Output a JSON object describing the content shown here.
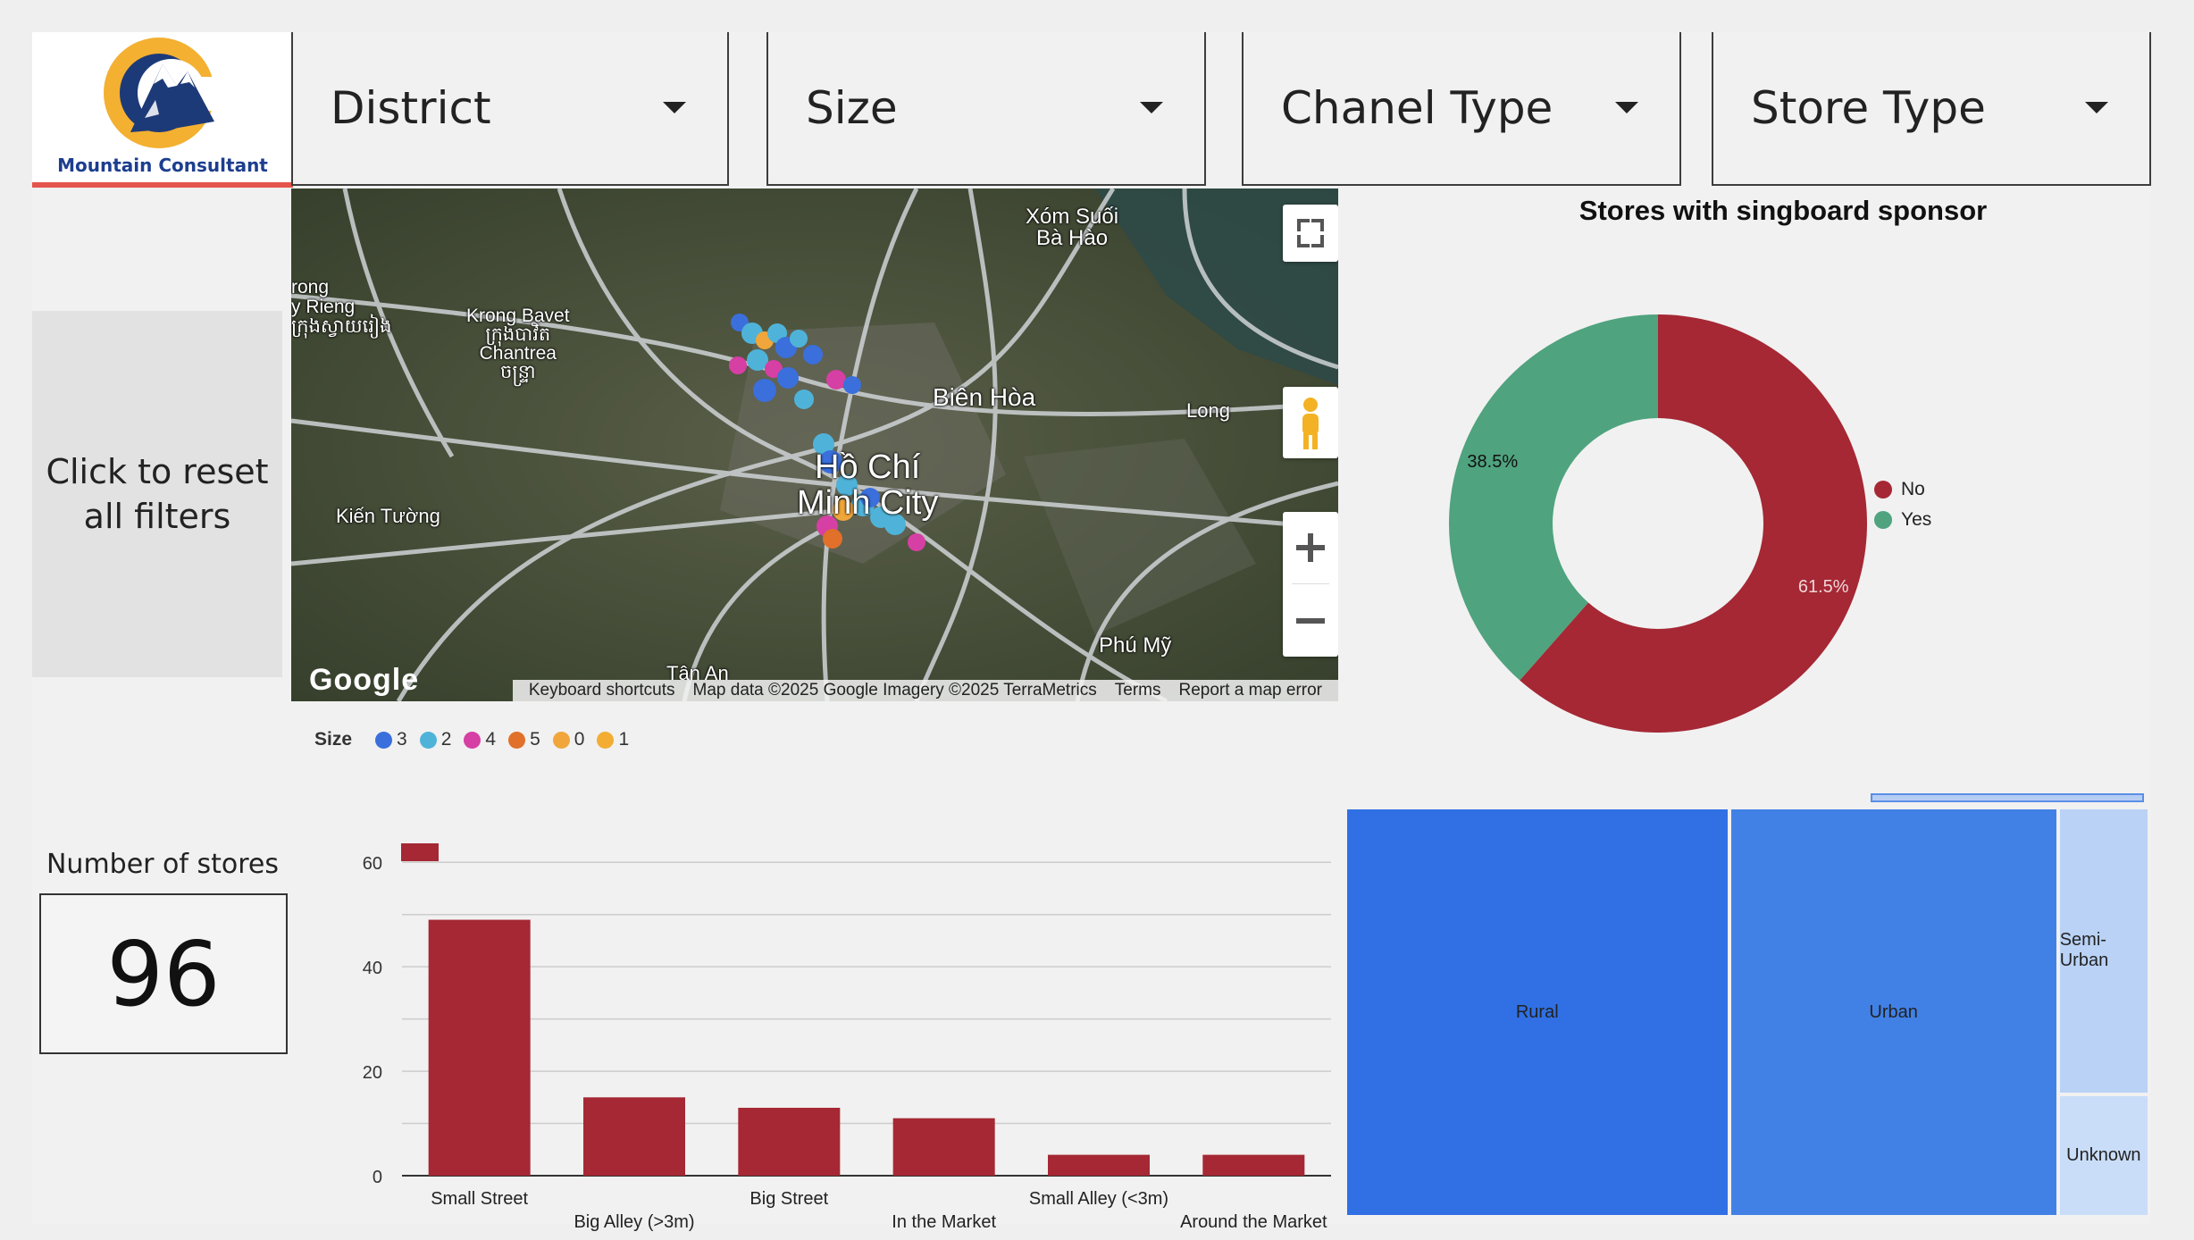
{
  "logo": {
    "text": "Mountain Consultant"
  },
  "filters": [
    {
      "label": "District"
    },
    {
      "label": "Size"
    },
    {
      "label": "Chanel Type"
    },
    {
      "label": "Store Type"
    }
  ],
  "reset": {
    "label": "Click to reset all filters"
  },
  "scorecard": {
    "title": "Number of stores",
    "value": "96"
  },
  "map": {
    "places": [
      "Xóm Suối",
      "Bà Hào",
      "Krong Bavet",
      "ក្រុងបាវិត",
      "Chantrea",
      "ចន្ទ្រា",
      "Biên Hòa",
      "Hồ Chí",
      "Minh City",
      "Kiến Tường",
      "Long",
      "Phú Mỹ",
      "Tân An",
      "rong",
      "y Rieng",
      "ក្រុងស្វាយរៀង"
    ],
    "attribution": {
      "brand": "Google",
      "keyboard": "Keyboard shortcuts",
      "data": "Map data ©2025 Google Imagery ©2025 TerraMetrics",
      "terms": "Terms",
      "report": "Report a map error"
    },
    "size_legend": {
      "title": "Size",
      "items": [
        {
          "label": "3",
          "color": "#3a6fdc"
        },
        {
          "label": "2",
          "color": "#4fb3d9"
        },
        {
          "label": "4",
          "color": "#d63fa3"
        },
        {
          "label": "5",
          "color": "#e0702a"
        },
        {
          "label": "0",
          "color": "#f0a63a"
        },
        {
          "label": "1",
          "color": "#f3ad33"
        }
      ]
    }
  },
  "chart_data": [
    {
      "type": "pie",
      "title": "Stores with singboard sponsor",
      "labels": [
        "No",
        "Yes"
      ],
      "values": [
        61.5,
        38.5
      ],
      "value_labels": [
        "61.5%",
        "38.5%"
      ],
      "colors": [
        "#a52834",
        "#4fa37e"
      ],
      "legend": "right"
    },
    {
      "type": "bar",
      "categories": [
        "Small Street",
        "Big Alley (>3m)",
        "Big Street",
        "In the Market",
        "Small Alley (<3m)",
        "Around the Market"
      ],
      "values": [
        49,
        15,
        13,
        11,
        4,
        4
      ],
      "ylim": [
        0,
        65
      ],
      "yticks": [
        "0",
        "20",
        "40",
        "60"
      ],
      "color": "#a52834",
      "grid": true
    },
    {
      "type": "treemap",
      "labels": [
        "Rural",
        "Urban",
        "Semi-Urban",
        "Unknown"
      ],
      "values": [
        42,
        36,
        7,
        3
      ],
      "colors": [
        "#3070e4",
        "#4181e6",
        "#b9d2f6",
        "#c9ddf8"
      ]
    }
  ]
}
